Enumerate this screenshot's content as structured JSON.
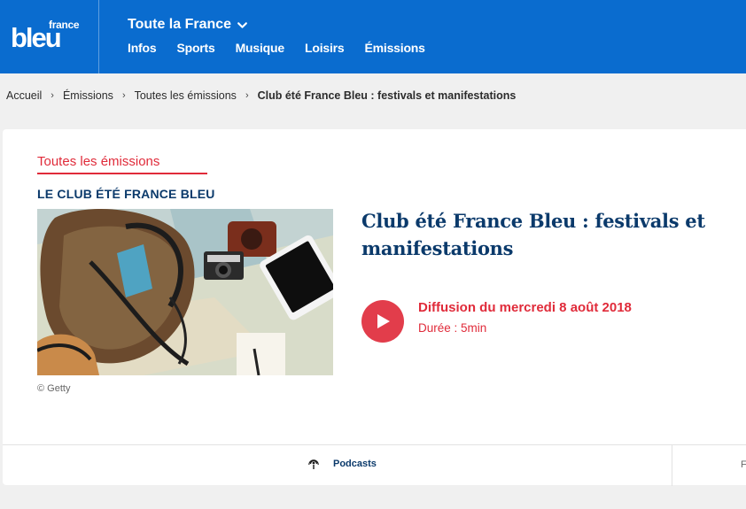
{
  "header": {
    "logo_small": "france",
    "logo_big": "bleu",
    "region": "Toute la France",
    "nav": [
      "Infos",
      "Sports",
      "Musique",
      "Loisirs",
      "Émissions"
    ]
  },
  "breadcrumb": {
    "items": [
      "Accueil",
      "Émissions",
      "Toutes les émissions"
    ],
    "current": "Club été France Bleu : festivals et manifestations",
    "separator": "›"
  },
  "card": {
    "category_link": "Toutes les émissions",
    "show_name": "LE CLUB ÉTÉ FRANCE BLEU",
    "image_credit": "© Getty",
    "episode_title": "Club été France Bleu : festivals et manifestations",
    "diffusion": "Diffusion du mercredi 8 août 2018",
    "duree": "Durée : 5min",
    "podcasts_label": "Podcasts",
    "next_tab_initial": "F"
  },
  "colors": {
    "brand_blue": "#0a6ccf",
    "accent_red": "#e02b3a",
    "title_navy": "#0b3a6b"
  }
}
